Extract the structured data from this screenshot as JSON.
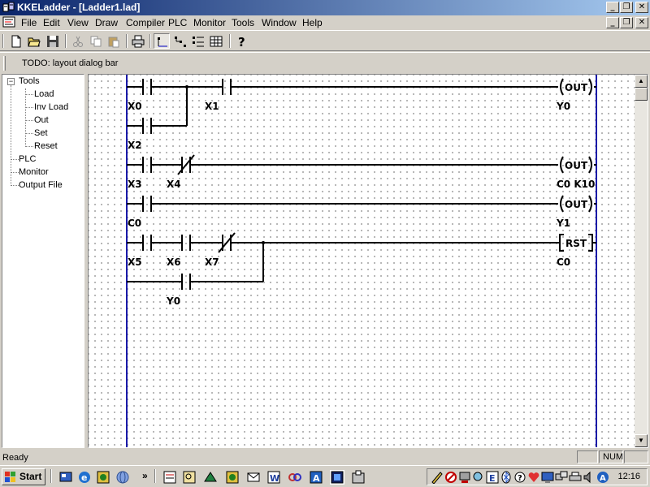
{
  "window": {
    "title": "KKELadder - [Ladder1.lad]",
    "minimize": "_",
    "restore": "❐",
    "close": "✕"
  },
  "menu": {
    "items": [
      "File",
      "Edit",
      "View",
      "Draw",
      "Compiler",
      "PLC",
      "Monitor",
      "Tools",
      "Window",
      "Help"
    ]
  },
  "toolbar": {
    "buttons": [
      "new-file-icon",
      "open-folder-icon",
      "save-disk-icon",
      "cut-icon",
      "copy-icon",
      "paste-icon",
      "print-icon",
      "draw-contact-icon",
      "draw-branch-icon",
      "draw-list-icon",
      "draw-grid-icon",
      "help-icon"
    ]
  },
  "dialog_bar": {
    "text": "TODO: layout dialog bar"
  },
  "tree": {
    "root": "Tools",
    "toggle": "−",
    "children": [
      "Load",
      "Inv Load",
      "Out",
      "Set",
      "Reset"
    ],
    "siblings": [
      "PLC",
      "Monitor",
      "Output File"
    ]
  },
  "ladder": {
    "rung_color": "#000000",
    "rail_color": "#1a1aa8",
    "labels": {
      "x0": "X0",
      "x1": "X1",
      "x2": "X2",
      "y0_out": "Y0",
      "x3": "X3",
      "x4": "X4",
      "c0_k10": "C0 K10",
      "c0_contact": "C0",
      "y1": "Y1",
      "x5": "X5",
      "x6": "X6",
      "x7": "X7",
      "c0_rst": "C0",
      "y0_contact": "Y0"
    },
    "coils": {
      "out1": "OUT",
      "out2": "OUT",
      "out3": "OUT",
      "rst": "RST"
    }
  },
  "statusbar": {
    "text": "Ready",
    "num": "NUM"
  },
  "taskbar": {
    "start": "Start",
    "chevron": "»",
    "clock": "12:16"
  }
}
